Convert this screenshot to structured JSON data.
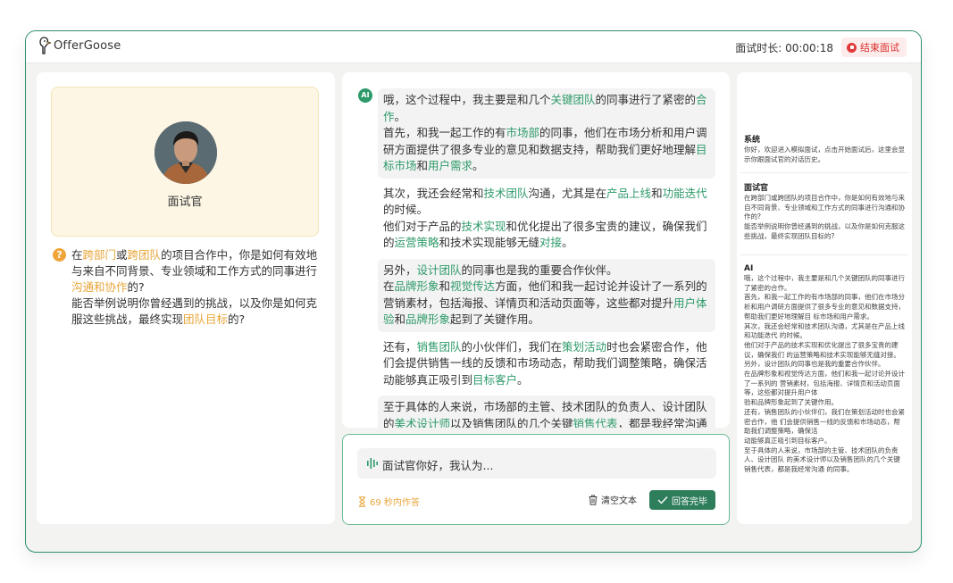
{
  "app": {
    "logo_text": "OfferGoose"
  },
  "header": {
    "timer_label": "面试时长: 00:00:18",
    "end_button": "结束面试"
  },
  "interviewer": {
    "label": "面试官",
    "question_parts": [
      {
        "text": "在",
        "hl": false
      },
      {
        "text": "跨部门",
        "hl": true
      },
      {
        "text": "或",
        "hl": false
      },
      {
        "text": "跨团队",
        "hl": true
      },
      {
        "text": "的项目合作中，你是如何有效地与来自不同背景、专业领域和工作方式的同事进行",
        "hl": false
      },
      {
        "text": "沟通和协作",
        "hl": true
      },
      {
        "text": "的?",
        "hl": false
      },
      {
        "text": "\n能否举例说明你曾经遇到的挑战，以及你是如何克服这些挑战，最终实现",
        "hl": false
      },
      {
        "text": "团队目标",
        "hl": true
      },
      {
        "text": "的?",
        "hl": false
      }
    ]
  },
  "chat": {
    "badge": "AI",
    "messages": [
      {
        "shade": true,
        "parts": [
          {
            "t": "哦，这个过程中，我主要是和几个"
          },
          {
            "t": "关键团队",
            "h": 1
          },
          {
            "t": "的同事进行了紧密的"
          },
          {
            "t": "合作",
            "h": 1
          },
          {
            "t": "。\n首先，和我一起工作的有"
          },
          {
            "t": "市场部",
            "h": 1
          },
          {
            "t": "的同事，他们在市场分析和用户调研方面提供了很多专业的意见和数据支持，帮助我们更好地理解"
          },
          {
            "t": "目标市场",
            "h": 1
          },
          {
            "t": "和"
          },
          {
            "t": "用户需求",
            "h": 1
          },
          {
            "t": "。"
          }
        ]
      },
      {
        "shade": false,
        "parts": [
          {
            "t": "其次，我还会经常和"
          },
          {
            "t": "技术团队",
            "h": 1
          },
          {
            "t": "沟通，尤其是在"
          },
          {
            "t": "产品上线",
            "h": 1
          },
          {
            "t": "和"
          },
          {
            "t": "功能迭代",
            "h": 1
          },
          {
            "t": "的时候。\n他们对于产品的"
          },
          {
            "t": "技术实现",
            "h": 1
          },
          {
            "t": "和优化提出了很多宝贵的建议，确保我们的"
          },
          {
            "t": "运营策略",
            "h": 1
          },
          {
            "t": "和技术实现能够无缝"
          },
          {
            "t": "对接",
            "h": 1
          },
          {
            "t": "。"
          }
        ]
      },
      {
        "shade": true,
        "parts": [
          {
            "t": "另外，"
          },
          {
            "t": "设计团队",
            "h": 1
          },
          {
            "t": "的同事也是我的重要合作伙伴。\n在"
          },
          {
            "t": "品牌形象",
            "h": 1
          },
          {
            "t": "和"
          },
          {
            "t": "视觉传达",
            "h": 1
          },
          {
            "t": "方面，他们和我一起讨论并设计了一系列的营销素材，包括海报、详情页和活动页面等，这些都对提升"
          },
          {
            "t": "用户体验",
            "h": 1
          },
          {
            "t": "和"
          },
          {
            "t": "品牌形象",
            "h": 1
          },
          {
            "t": "起到了关键作用。"
          }
        ]
      },
      {
        "shade": false,
        "parts": [
          {
            "t": "还有，"
          },
          {
            "t": "销售团队",
            "h": 1
          },
          {
            "t": "的小伙伴们，我们在"
          },
          {
            "t": "策划活动",
            "h": 1
          },
          {
            "t": "时也会紧密合作，他们会提供销售一线的反馈和市场动态，帮助我们调整策略，确保活动能够真正吸引到"
          },
          {
            "t": "目标客户",
            "h": 1
          },
          {
            "t": "。"
          }
        ]
      },
      {
        "shade": true,
        "parts": [
          {
            "t": "至于具体的人来说，市场部的主管、技术团队的负责人、设计团队的"
          },
          {
            "t": "美术设计师",
            "h": 1
          },
          {
            "t": "以及销售团队的几个关键"
          },
          {
            "t": "销售代表",
            "h": 1
          },
          {
            "t": "，都是我经常沟通的同事。"
          }
        ]
      }
    ]
  },
  "input": {
    "value": "面试官你好，我认为...",
    "countdown": "69 秒内作答",
    "clear_label": "清空文本",
    "done_label": "回答完毕"
  },
  "history": [
    {
      "title": "系统",
      "body": "你好，欢迎进入模拟面试，点击开始面试后，这里会显示你跟面试官的对话历史。"
    },
    {
      "title": "面试官",
      "body": "在跨部门或跨团队的项目合作中，你是如何有效地与来自不同背景、专业领域和工作方式的同事进行沟通和协作的?\n能否举例说明你曾经遇到的挑战，以及你是如何克服这些挑战，最终实现团队目标的?"
    },
    {
      "title": "AI",
      "body": "哦，这个过程中，我主要是和几个关键团队的同事进行了紧密的合作。\n首先，和我一起工作的有市场部的同事，他们在市场分析和用户调研方面提供了很多专业的意见和数据支持，帮助我们更好地理解目 标市场和用户需求。\n其次，我还会经常和技术团队沟通，尤其是在产品上线和功能迭代 的时候。\n他们对于产品的技术实现和优化提出了很多宝贵的建议，确保我们 的运营策略和技术实现能够无缝对接。\n另外，设计团队的同事也是我的重要合作伙伴。\n在品牌形象和视觉传达方面，他们和我一起讨论并设计了一系列的 营销素材，包括海报、详情页和活动页面等，这些都对提升用户体\n验和品牌形象起到了关键作用。\n还有，销售团队的小伙伴们，我们在策划活动时也会紧密合作，他 们会提供销售一线的反馈和市场动态，帮助我们调整策略，确保活\n动能够真正吸引到目标客户。\n至于具体的人来说，市场部的主管、技术团队的负责人、设计团队 的美术设计师以及销售团队的几个关键销售代表，都是我经常沟通 的同事。"
    }
  ],
  "colors": {
    "accent": "#2e9a6a",
    "highlight": "#e8a63a",
    "danger": "#e03a3a"
  }
}
